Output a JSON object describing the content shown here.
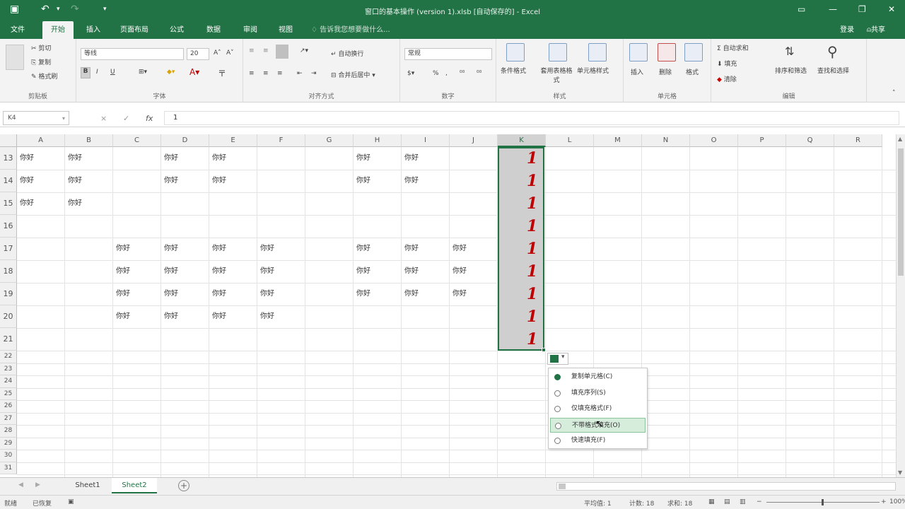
{
  "title_bar": {
    "title": "窗口的基本操作 (version 1).xlsb [自动保存的] - Excel",
    "save_icon": "floppy-icon",
    "undo_icon": "undo-icon"
  },
  "ribbon_tabs": [
    "文件",
    "开始",
    "插入",
    "页面布局",
    "公式",
    "数据",
    "审阅",
    "视图"
  ],
  "active_tab": "开始",
  "tell_me": "告诉我您想要做什么...",
  "account": {
    "login": "登录",
    "share": "共享"
  },
  "ribbon": {
    "clipboard": {
      "cut": "剪切",
      "copy": "复制",
      "format_painter": "格式刷",
      "label": "剪贴板"
    },
    "font": {
      "name": "等线",
      "size": "20",
      "bold": "B",
      "italic": "I",
      "underline": "U",
      "label": "字体"
    },
    "alignment": {
      "wrap": "自动换行",
      "merge": "合并后居中",
      "label": "对齐方式"
    },
    "number": {
      "format": "常规",
      "percent": "%",
      "label": "数字"
    },
    "styles": {
      "conditional": "条件格式",
      "table": "套用表格格式",
      "cell": "单元格样式",
      "label": "样式"
    },
    "cells": {
      "insert": "插入",
      "delete": "删除",
      "format": "格式",
      "label": "单元格"
    },
    "editing": {
      "autosum": "自动求和",
      "fill": "填充",
      "clear": "清除",
      "sort": "排序和筛选",
      "find": "查找和选择",
      "label": "编辑"
    }
  },
  "formula_bar": {
    "name_box": "K4",
    "value": "1",
    "fx": "fx",
    "cancel": "×",
    "enter": "✓"
  },
  "columns": [
    "A",
    "B",
    "C",
    "D",
    "E",
    "F",
    "G",
    "H",
    "I",
    "J",
    "K",
    "L",
    "M",
    "N",
    "O",
    "P",
    "Q",
    "R"
  ],
  "selected_column": "K",
  "tall_rows": [
    "13",
    "14",
    "15",
    "16",
    "17",
    "18",
    "19",
    "20",
    "21"
  ],
  "short_rows": [
    "22",
    "23",
    "24",
    "25",
    "26",
    "27",
    "28",
    "29",
    "30",
    "31"
  ],
  "cell_text": "你好",
  "rows_data": [
    [
      "你好",
      "你好",
      "",
      "你好",
      "你好",
      "",
      "",
      "你好",
      "你好",
      ""
    ],
    [
      "你好",
      "你好",
      "",
      "你好",
      "你好",
      "",
      "",
      "你好",
      "你好",
      ""
    ],
    [
      "你好",
      "你好",
      "",
      "",
      "",
      "",
      "",
      "",
      "",
      ""
    ],
    [
      "",
      "",
      "",
      "",
      "",
      "",
      "",
      "",
      "",
      ""
    ],
    [
      "",
      "",
      "你好",
      "你好",
      "你好",
      "你好",
      "",
      "你好",
      "你好",
      "你好"
    ],
    [
      "",
      "",
      "你好",
      "你好",
      "你好",
      "你好",
      "",
      "你好",
      "你好",
      "你好"
    ],
    [
      "",
      "",
      "你好",
      "你好",
      "你好",
      "你好",
      "",
      "你好",
      "你好",
      "你好"
    ],
    [
      "",
      "",
      "你好",
      "你好",
      "你好",
      "你好",
      "",
      "",
      "",
      ""
    ],
    [
      "",
      "",
      "",
      "",
      "",
      "",
      "",
      "",
      "",
      ""
    ]
  ],
  "column_k_values": [
    "1",
    "1",
    "1",
    "1",
    "1",
    "1",
    "1",
    "1",
    "1"
  ],
  "autofill_menu": [
    {
      "label": "复制单元格(C)",
      "selected": true
    },
    {
      "label": "填充序列(S)",
      "selected": false
    },
    {
      "label": "仅填充格式(F)",
      "selected": false
    },
    {
      "label": "不带格式填充(O)",
      "selected": false,
      "hover": true
    },
    {
      "label": "快速填充(F)",
      "selected": false
    }
  ],
  "sheets": [
    "Sheet1",
    "Sheet2"
  ],
  "active_sheet": "Sheet2",
  "status_bar": {
    "ready": "就绪",
    "accessibility": "已恢复",
    "average": "平均值: 1",
    "count": "计数: 18",
    "sum": "求和: 18",
    "zoom": "100%"
  }
}
